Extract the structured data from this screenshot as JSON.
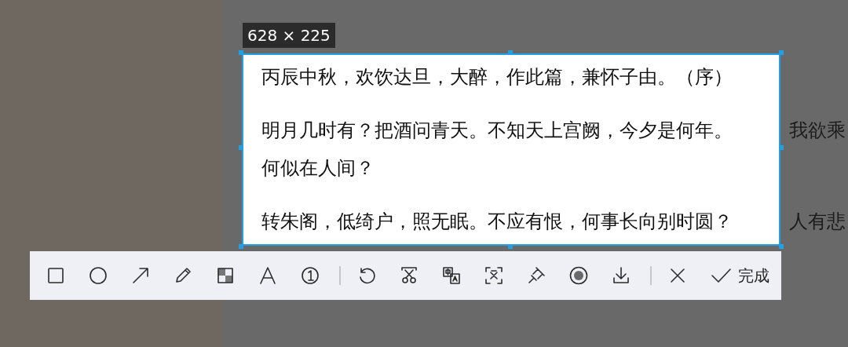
{
  "size_label": "628 × 225",
  "selection": {
    "paragraphs": [
      {
        "lines": [
          {
            "text": "丙辰中秋，欢饮达旦，大醉，作此篇，兼怀子由。（序）"
          }
        ]
      },
      {
        "lines": [
          {
            "text": "明月几时有？把酒问青天。不知天上宫阙，今夕是何年。",
            "outside": "我欲乘"
          },
          {
            "text": "何似在人间？"
          }
        ]
      },
      {
        "lines": [
          {
            "text": "转朱阁，低绮户，照无眠。不应有恨，何事长向别时圆？",
            "outside": "人有悲"
          }
        ]
      }
    ]
  },
  "toolbar": {
    "done_label": "完成"
  }
}
